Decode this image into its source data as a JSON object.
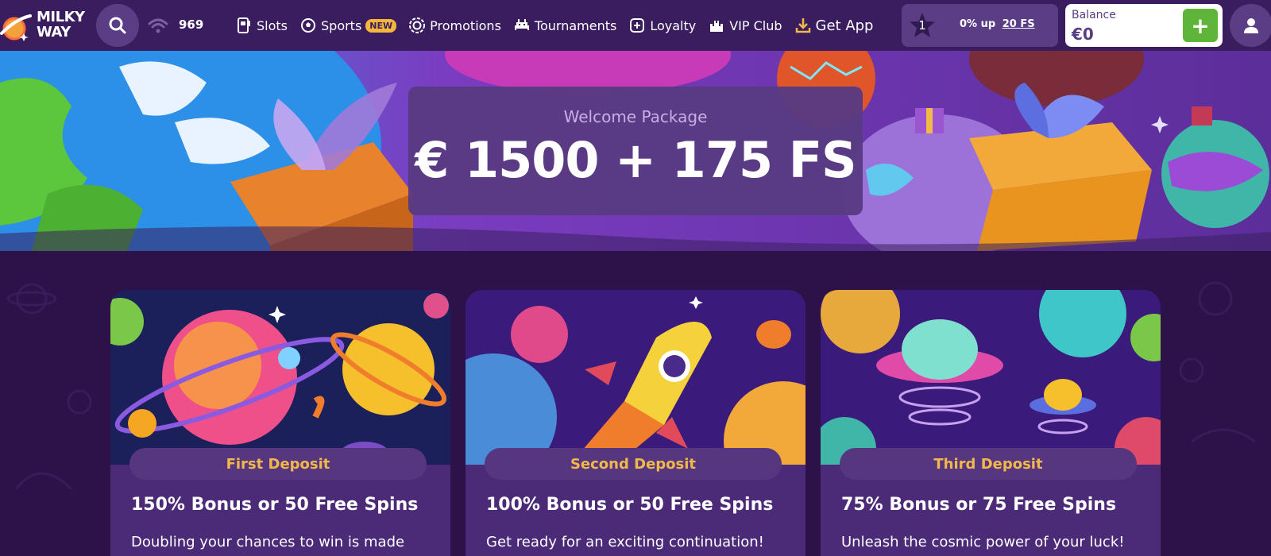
{
  "brand": {
    "line1": "MILKY",
    "line2": "WAY"
  },
  "header": {
    "online_count": "969",
    "nav": [
      {
        "label": "Slots",
        "icon": "slot-machine-icon"
      },
      {
        "label": "Sports",
        "icon": "soccer-ball-icon",
        "badge": "NEW"
      },
      {
        "label": "Promotions",
        "icon": "gear-badge-icon"
      },
      {
        "label": "Tournaments",
        "icon": "invader-icon"
      },
      {
        "label": "Loyalty",
        "icon": "loyalty-icon"
      },
      {
        "label": "VIP Club",
        "icon": "castle-icon"
      },
      {
        "label": "Get App",
        "icon": "download-icon"
      }
    ],
    "level": {
      "number": "1",
      "text": "0% up",
      "reward": "20 FS"
    },
    "balance": {
      "label": "Balance",
      "value": "€0",
      "add_symbol": "+"
    }
  },
  "hero": {
    "subtitle": "Welcome Package",
    "amount": "€ 1500 + 175 FS"
  },
  "cards": [
    {
      "tag": "First Deposit",
      "title": "150% Bonus or 50 Free Spins",
      "desc": "Doubling your chances to win is made"
    },
    {
      "tag": "Second Deposit",
      "title": "100% Bonus or 50 Free Spins",
      "desc": "Get ready for an exciting continuation!"
    },
    {
      "tag": "Third Deposit",
      "title": "75% Bonus or 75 Free Spins",
      "desc": "Unleash the cosmic power of your luck!"
    }
  ],
  "colors": {
    "topbar": "#3a1d5e",
    "accent_gold": "#f2b94a",
    "deposit_green": "#5fb43a",
    "page_bg": "#2c1249"
  }
}
